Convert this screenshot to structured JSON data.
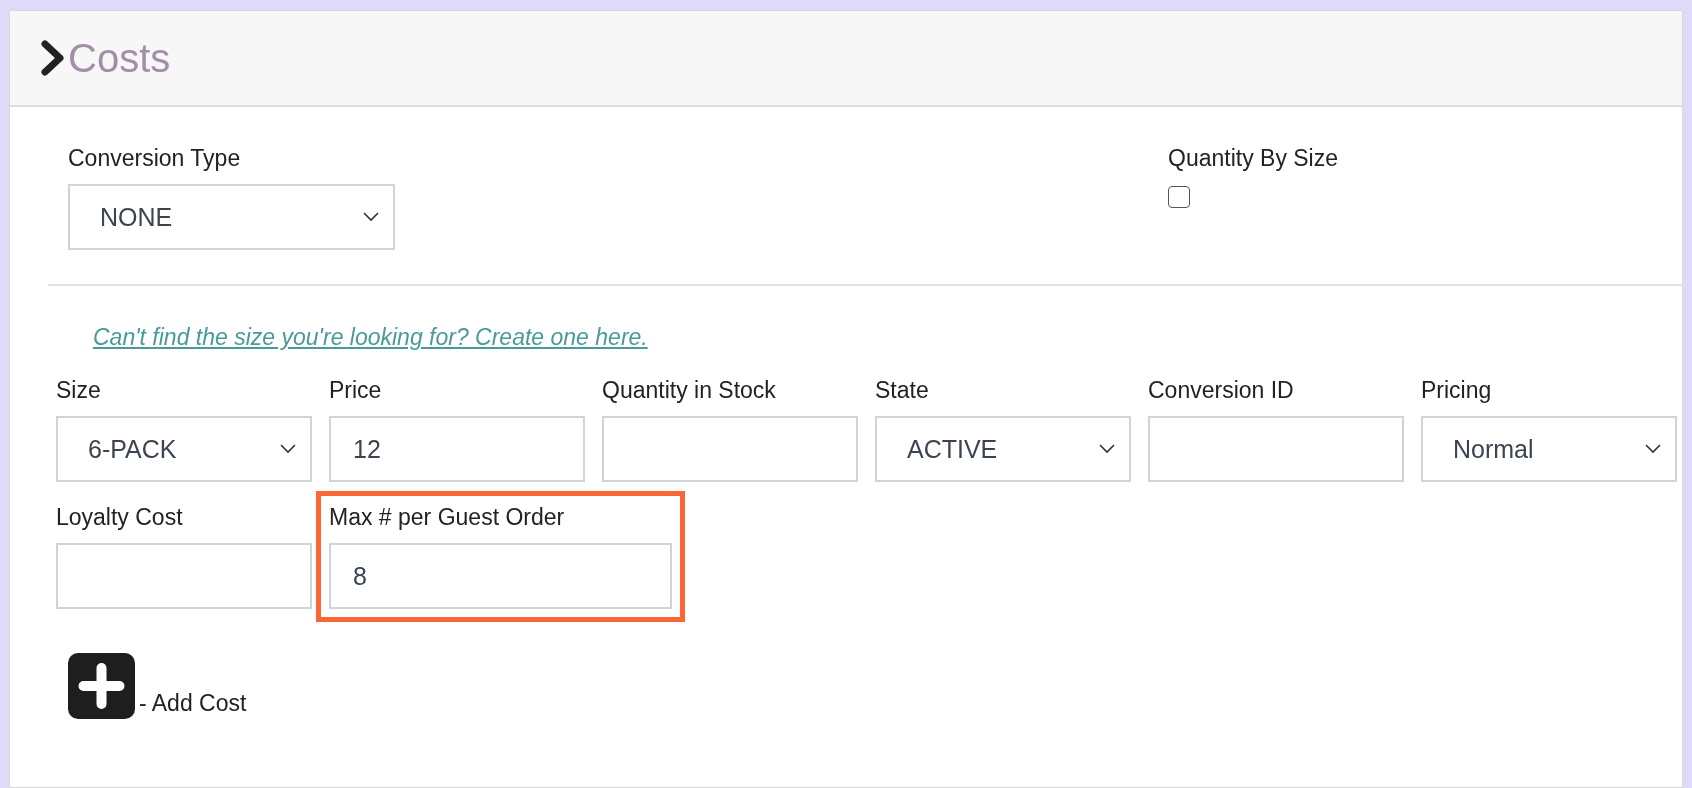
{
  "panel": {
    "title": "Costs"
  },
  "conversion_type": {
    "label": "Conversion Type",
    "value": "NONE"
  },
  "quantity_by_size": {
    "label": "Quantity By Size",
    "checked": false
  },
  "create_size_link": "Can't find the size you're looking for? Create one here.",
  "cost_rows": [
    [
      {
        "label": "Size",
        "kind": "select",
        "value": "6-PACK",
        "highlighted": false
      },
      {
        "label": "Price",
        "kind": "text",
        "value": "12",
        "highlighted": false
      },
      {
        "label": "Quantity in Stock",
        "kind": "text",
        "highlighted": false
      },
      {
        "label": "State",
        "kind": "select",
        "value": "ACTIVE",
        "highlighted": false
      },
      {
        "label": "Conversion ID",
        "kind": "text",
        "highlighted": false
      },
      {
        "label": "Pricing",
        "kind": "select",
        "value": "Normal",
        "highlighted": false
      }
    ],
    [
      {
        "label": "Loyalty Cost",
        "kind": "text",
        "highlighted": false
      },
      {
        "label": "Max # per Guest Order",
        "kind": "text",
        "value": "8",
        "highlighted": true
      }
    ]
  ],
  "add_cost": {
    "label": "- Add Cost"
  }
}
